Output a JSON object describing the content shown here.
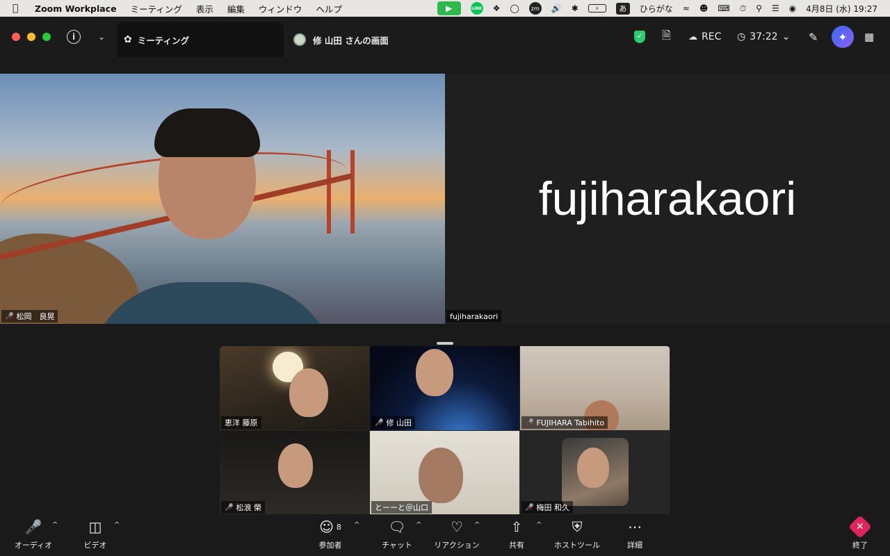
{
  "menubar": {
    "app_name": "Zoom Workplace",
    "menus": [
      "ミーティング",
      "表示",
      "編集",
      "ウィンドウ",
      "ヘルプ"
    ],
    "line_label": "LINE",
    "zm_label": "zm",
    "ime_box": "あ",
    "ime_label": "ひらがな",
    "clock": "4月8日 (水)  19:27"
  },
  "titlebar": {
    "meeting_tab": "ミーティング",
    "share_tab": "修 山田 さんの画面",
    "rec_label": "REC",
    "timer": "37:22"
  },
  "stage": {
    "main_tile_name": "松岡　良晃",
    "name_tile_big": "fujiharakaori",
    "name_tile_label": "fujiharakaori"
  },
  "gallery": [
    {
      "name": "恵洋 藤原",
      "muted": false
    },
    {
      "name": "修 山田",
      "muted": true
    },
    {
      "name": "FUJIHARA Tabihito",
      "muted": true
    },
    {
      "name": "松浪 榮",
      "muted": true
    },
    {
      "name": "とーーと＠山口",
      "muted": false
    },
    {
      "name": "梅田 和久",
      "muted": true
    }
  ],
  "toolbar": {
    "audio": "オーディオ",
    "video": "ビデオ",
    "participants": "参加者",
    "participant_count": "8",
    "chat": "チャット",
    "reactions": "リアクション",
    "share": "共有",
    "host_tools": "ホストツール",
    "more": "詳細",
    "end": "終了"
  },
  "colors": {
    "end_button": "#e0245e",
    "mute_icon": "#ff4d4d",
    "security_shield": "#2ecc71",
    "ai_companion": "#5a6cf4"
  }
}
